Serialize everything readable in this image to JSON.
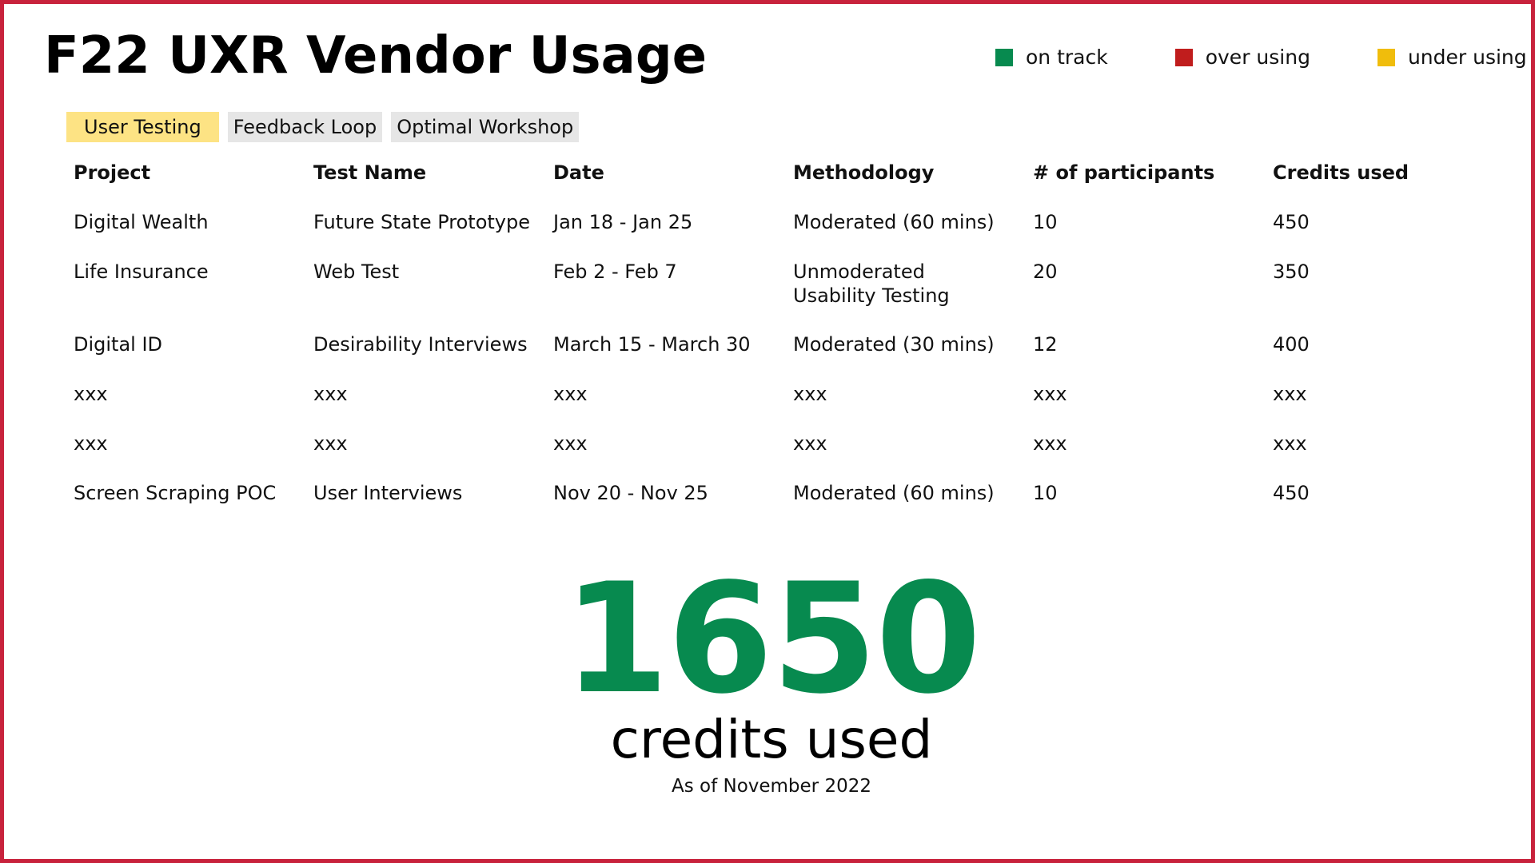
{
  "title": "F22 UXR Vendor Usage",
  "legend": [
    {
      "label": "on track",
      "color": "#078a4f"
    },
    {
      "label": "over using",
      "color": "#c01d1d"
    },
    {
      "label": "under using",
      "color": "#f0bd0c"
    }
  ],
  "tabs": [
    {
      "label": "User Testing",
      "active": true
    },
    {
      "label": "Feedback Loop",
      "active": false
    },
    {
      "label": "Optimal Workshop",
      "active": false
    }
  ],
  "table": {
    "headers": [
      "Project",
      "Test Name",
      "Date",
      "Methodology",
      "# of participants",
      "Credits used"
    ],
    "rows": [
      [
        "Digital Wealth",
        "Future State Prototype",
        "Jan 18 - Jan 25",
        "Moderated (60 mins)",
        "10",
        "450"
      ],
      [
        "Life Insurance",
        "Web Test",
        "Feb 2 - Feb 7",
        "Unmoderated\nUsability Testing",
        "20",
        "350"
      ],
      [
        "Digital ID",
        "Desirability Interviews",
        "March 15 - March 30",
        "Moderated (30 mins)",
        "12",
        "400"
      ],
      [
        "xxx",
        "xxx",
        "xxx",
        "xxx",
        "xxx",
        "xxx"
      ],
      [
        "xxx",
        "xxx",
        "xxx",
        "xxx",
        "xxx",
        "xxx"
      ],
      [
        "Screen Scraping POC",
        "User Interviews",
        "Nov 20 - Nov 25",
        "Moderated (60 mins)",
        "10",
        "450"
      ]
    ]
  },
  "summary": {
    "total": "1650",
    "label": "credits used",
    "as_of": "As of November 2022",
    "status_color": "#078a4f"
  },
  "colors": {
    "border": "#c8223c",
    "active_tab": "#fde384",
    "inactive_tab": "#e6e6e6"
  }
}
